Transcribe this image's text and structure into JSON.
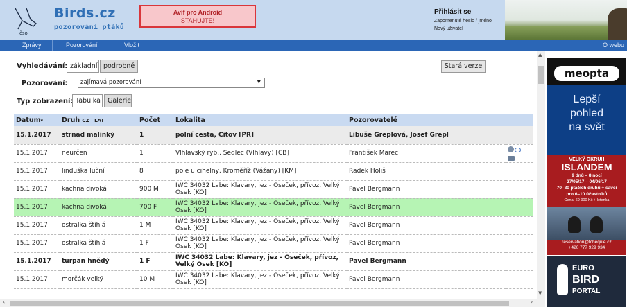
{
  "header": {
    "logo_caption": "čso",
    "site_title": "Birds.cz",
    "site_subtitle": "pozorování ptáků",
    "banner_line1": "Avif pro Android",
    "banner_line2": "STAHUJTE!",
    "login_title": "Přihlásit se",
    "forgot_link": "Zapomenuté heslo / jméno",
    "new_user_link": "Nový uživatel"
  },
  "nav": {
    "items": [
      "Zprávy",
      "Pozorování",
      "Vložit"
    ],
    "right_item": "O webu"
  },
  "search": {
    "label": "Vyhledávání:",
    "tab_basic": "základní",
    "tab_advanced": "podrobné",
    "old_version": "Stará verze",
    "obs_label": "Pozorování:",
    "obs_value": "zajímavá pozorování",
    "view_label": "Typ zobrazení:",
    "view_table": "Tabulka",
    "view_gallery": "Galerie"
  },
  "table": {
    "headers": {
      "date": "Datum",
      "species": "Druh",
      "lang_toggle": "CZ | LAT",
      "count": "Počet",
      "locality": "Lokalita",
      "observers": "Pozorovatelé"
    },
    "rows": [
      {
        "date": "15.1.2017",
        "species": "strnad malinký",
        "count": "1",
        "locality": "polní cesta, Citov [PR]",
        "observers": "Libuše Greplová, Josef Grepl",
        "style": "grey bold"
      },
      {
        "date": "15.1.2017",
        "species": "neurčen",
        "count": "1",
        "locality": "Vlhlavský ryb., Sedlec (Vlhlavy) [CB]",
        "observers": "František Marec",
        "style": "icons"
      },
      {
        "date": "15.1.2017",
        "species": "linduška luční",
        "count": "8",
        "locality": "pole u cihelny, Kroměříž (Vážany) [KM]",
        "observers": "Radek Holiš",
        "style": ""
      },
      {
        "date": "15.1.2017",
        "species": "kachna divoká",
        "count": "900 M",
        "locality": "IWC 34032 Labe: Klavary, jez - Oseček, přívoz, Velký Osek [KO]",
        "observers": "Pavel Bergmann",
        "style": ""
      },
      {
        "date": "15.1.2017",
        "species": "kachna divoká",
        "count": "700 F",
        "locality": "IWC 34032 Labe: Klavary, jez - Oseček, přívoz, Velký Osek [KO]",
        "observers": "Pavel Bergmann",
        "style": "green"
      },
      {
        "date": "15.1.2017",
        "species": "ostralka štíhlá",
        "count": "1 M",
        "locality": "IWC 34032 Labe: Klavary, jez - Oseček, přívoz, Velký Osek [KO]",
        "observers": "Pavel Bergmann",
        "style": ""
      },
      {
        "date": "15.1.2017",
        "species": "ostralka štíhlá",
        "count": "1 F",
        "locality": "IWC 34032 Labe: Klavary, jez - Oseček, přívoz, Velký Osek [KO]",
        "observers": "Pavel Bergmann",
        "style": ""
      },
      {
        "date": "15.1.2017",
        "species": "turpan hnědý",
        "count": "1 F",
        "locality": "IWC 34032 Labe: Klavary, jez - Oseček, přívoz, Velký Osek [KO]",
        "observers": "Pavel Bergmann",
        "style": "bold"
      },
      {
        "date": "15.1.2017",
        "species": "morčák velký",
        "count": "10 M",
        "locality": "IWC 34032 Labe: Klavary, jez - Oseček, přívoz, Velký Osek [KO]",
        "observers": "Pavel Bergmann",
        "style": ""
      }
    ]
  },
  "ads": {
    "meopta": {
      "brand": "meopta",
      "line1": "Lepší",
      "line2": "pohled",
      "line3": "na svět"
    },
    "island": {
      "l1": "VELKÝ OKRUH",
      "l2": "ISLANDEM",
      "l3": "9 dnů – 8 nocí",
      "l4": "27/05/17 – 04/06/17",
      "l5": "70–80 ptačích druhů + savci",
      "l6": "pro 6–10 účastníků",
      "l7": "Cena: 69 900 Kč + letenka",
      "l8": "reservation@tchequie.cz",
      "l9": "+420 777 929 934"
    },
    "eurobird": {
      "w1": "EURO",
      "w2": "BIRD",
      "w3": "PORTAL"
    }
  },
  "colors": {
    "header_bg": "#c6d9ef",
    "nav_bg": "#2b66b6",
    "table_header_bg": "#c9daf1",
    "highlight_green": "#b6f4b4",
    "highlight_grey": "#ebebeb",
    "banner_red": "#d9363b"
  }
}
